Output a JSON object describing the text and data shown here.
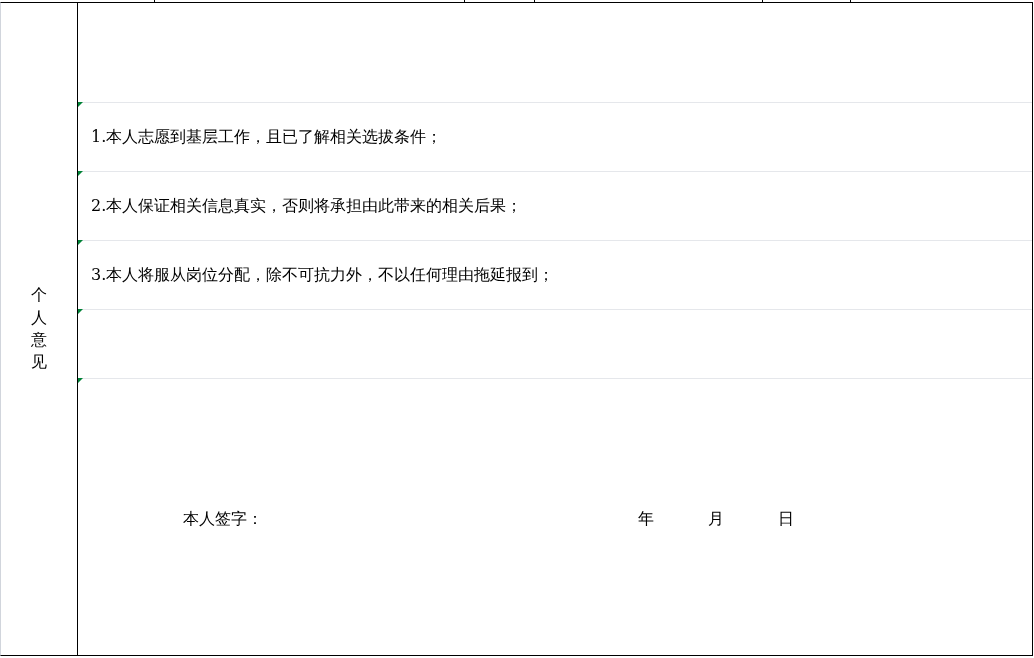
{
  "section_label": "个人意见",
  "statements": [
    {
      "text": "1.本人志愿到基层工作，且已了解相关选拔条件；"
    },
    {
      "text": "2.本人保证相关信息真实，否则将承担由此带来的相关后果；"
    },
    {
      "text": "3.本人将服从岗位分配，除不可抗力外，不以任何理由拖延报到；"
    }
  ],
  "signature": {
    "label": "本人签字：",
    "date_units": [
      "年",
      "月",
      "日"
    ]
  }
}
